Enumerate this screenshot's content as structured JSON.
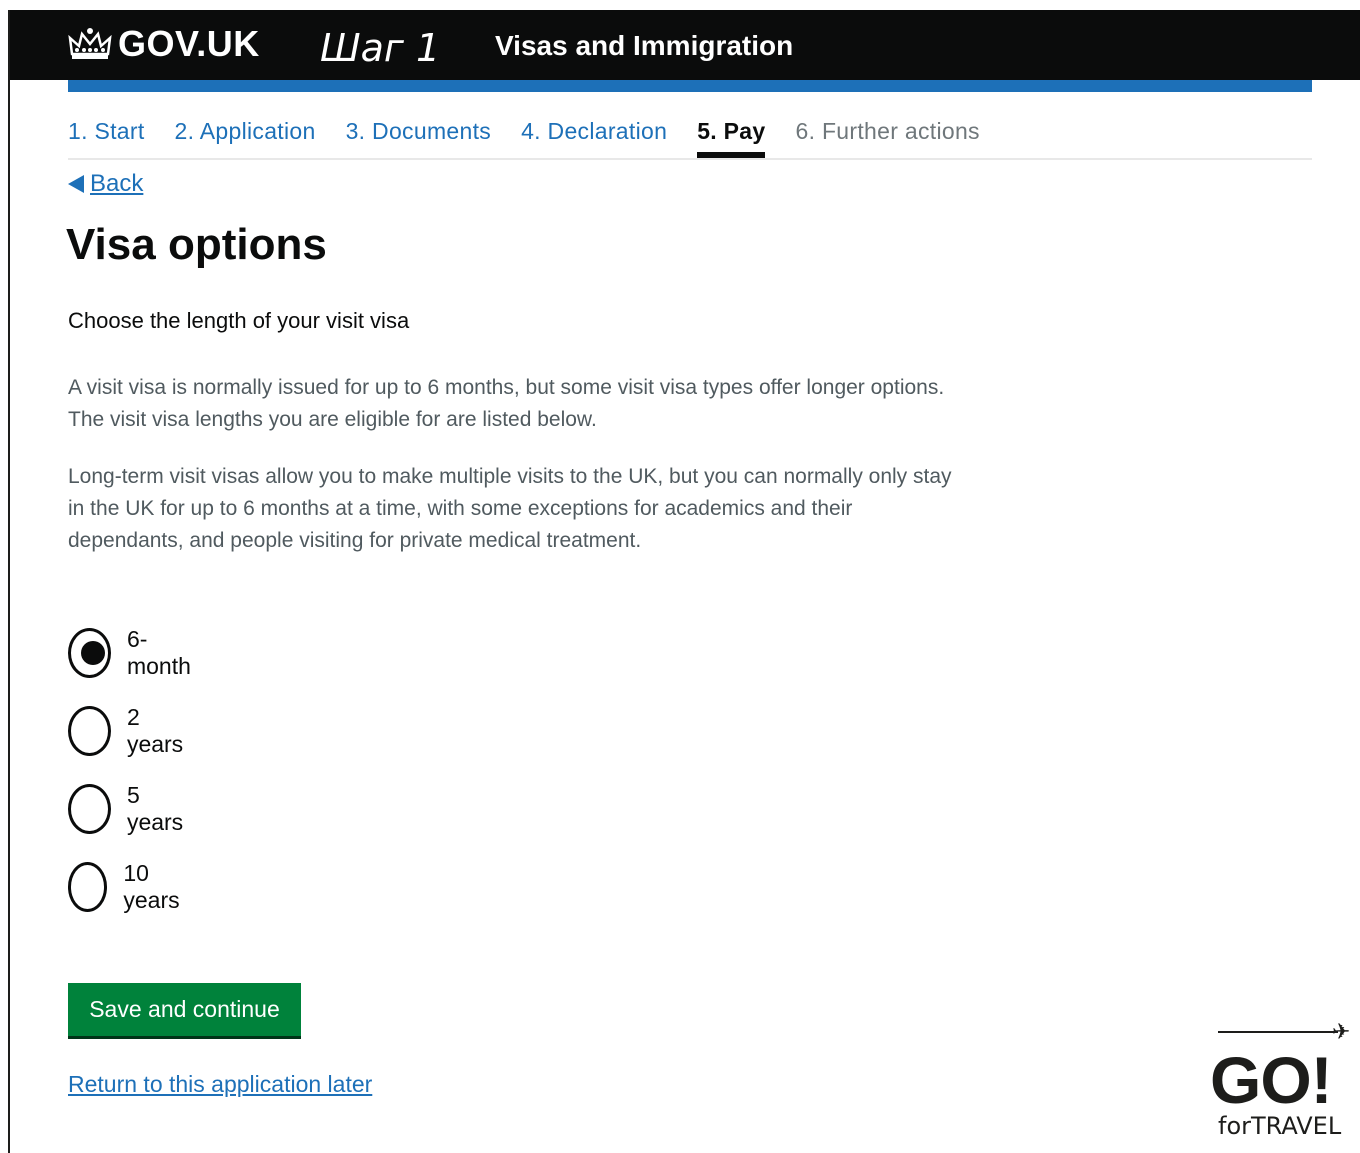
{
  "header": {
    "logo_text": "GOV.UK",
    "step_annotation": "Шаг 1",
    "service_name": "Visas and Immigration"
  },
  "steps": [
    {
      "label": "1. Start",
      "state": "done"
    },
    {
      "label": "2. Application",
      "state": "done"
    },
    {
      "label": "3. Documents",
      "state": "done"
    },
    {
      "label": "4. Declaration",
      "state": "done"
    },
    {
      "label": "5. Pay",
      "state": "current"
    },
    {
      "label": "6. Further actions",
      "state": "future"
    }
  ],
  "back_label": "Back",
  "page_title": "Visa options",
  "lead_text": "Choose the length of your visit visa",
  "paragraphs": [
    "A visit visa is normally issued for up to 6 months, but some visit visa types offer longer options. The visit visa lengths you are eligible for are listed below.",
    "Long-term visit visas allow you to make multiple visits to the UK, but you can normally only stay in the UK for up to 6 months at a time, with some exceptions for academics and their dependants, and people visiting for private medical treatment."
  ],
  "options": [
    {
      "label": "6-month",
      "checked": true
    },
    {
      "label": "2 years",
      "checked": false
    },
    {
      "label": "5 years",
      "checked": false
    },
    {
      "label": "10 years",
      "checked": false
    }
  ],
  "save_button_label": "Save and continue",
  "return_link_label": "Return to this application later",
  "watermark": {
    "main": "GO!",
    "sub": "forTRAVEL"
  },
  "colors": {
    "header_bg": "#0b0c0c",
    "accent_blue": "#1d70b8",
    "button_green": "#00823b"
  },
  "icons": {
    "logo": "crown-icon",
    "back": "back-arrow-icon",
    "plane": "plane-icon"
  }
}
